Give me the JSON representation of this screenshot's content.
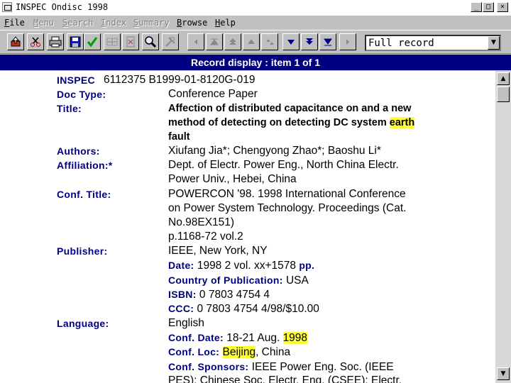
{
  "window": {
    "title": "INSPEC Ondisc 1998",
    "min_glyph": "_",
    "max_glyph": "□",
    "close_glyph": "×"
  },
  "menu": {
    "file": {
      "u": "F",
      "rest": "ile"
    },
    "menu": {
      "u": "M",
      "rest": "enu"
    },
    "search": {
      "u": "S",
      "rest": "earch"
    },
    "index": {
      "u": "I",
      "rest": "ndex"
    },
    "summary": {
      "u": "S",
      "rest": "ummary"
    },
    "browse": {
      "u": "B",
      "rest": "rowse"
    },
    "help": {
      "u": "H",
      "rest": "elp"
    }
  },
  "toolbar": {
    "format_select": "Full record"
  },
  "header": {
    "title": "Record display : item 1 of 1"
  },
  "record": {
    "db_label": "INSPEC",
    "db_value": "6112375 B1999-01-8120G-019",
    "doc_type_label": "Doc Type:",
    "doc_type": "Conference Paper",
    "title_label": "Title:",
    "title_l1": "Affection of distributed capacitance on and a new",
    "title_l2_pre": "method of detecting on detecting DC system ",
    "title_l2_hl": "earth",
    "title_l3": "fault",
    "authors_label": "Authors:",
    "authors": "Xiufang Jia*; Chengyong Zhao*; Baoshu Li*",
    "affiliation_label": "Affiliation:*",
    "affiliation_l1": "Dept. of Electr. Power Eng., North China Electr.",
    "affiliation_l2": "Power Univ., Hebei, China",
    "conf_title_label": "Conf. Title:",
    "conf_title_l1": "POWERCON '98. 1998 International Conference",
    "conf_title_l2": "on Power System Technology. Proceedings (Cat.",
    "conf_title_l3": "No.98EX151)",
    "conf_title_l4": "p.1168-72 vol.2",
    "publisher_label": "Publisher:",
    "publisher": "IEEE, New York, NY",
    "date_label": "Date:",
    "date_value": " 1998   2 vol. xx+1578 ",
    "pp_label": "pp.",
    "country_label": "Country of Publication:",
    "country": " USA",
    "isbn_label": "ISBN:",
    "isbn": " 0 7803 4754 4",
    "ccc_label": "CCC:",
    "ccc": " 0 7803 4754 4/98/$10.00",
    "language_label": "Language:",
    "language": "English",
    "conf_date_label": "Conf. Date:",
    "conf_date_pre": " 18-21 Aug. ",
    "conf_date_hl": "1998",
    "conf_loc_label": "Conf. Loc:",
    "conf_loc_hl": "Beijing",
    "conf_loc_post": ", China",
    "conf_sponsors_label": "Conf. Sponsors:",
    "conf_sponsors_l1": " IEEE Power Eng. Soc. (IEEE",
    "conf_sponsors_l2": "PES); Chinese Soc. Electr. Eng. (CSEE); Electr."
  },
  "icons": [
    "export-icon",
    "scissors-icon",
    "print-icon",
    "save-icon",
    "check-icon",
    "grid-icon",
    "clear-icon",
    "search-icon",
    "tools-icon",
    "prev-icon",
    "first-icon",
    "page-up-icon",
    "up-icon",
    "down-icon",
    "page-down-icon",
    "last-icon",
    "next-icon"
  ]
}
